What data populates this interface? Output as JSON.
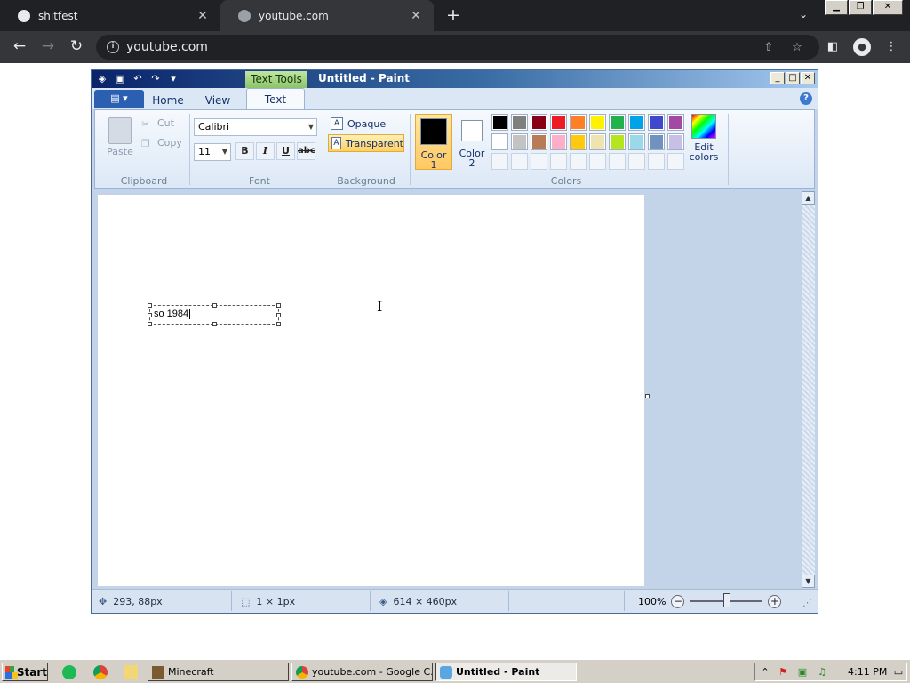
{
  "browser": {
    "tabs": [
      {
        "title": "shitfest",
        "close": "✕"
      },
      {
        "title": "youtube.com",
        "close": "✕"
      }
    ],
    "new_tab": "+",
    "url": "youtube.com",
    "window_controls": [
      "▁",
      "❐",
      "✕"
    ]
  },
  "paint": {
    "contextual_tab": "Text Tools",
    "title": "Untitled - Paint",
    "file_menu": "▤ ▾",
    "tabs": [
      "Home",
      "View",
      "Text"
    ],
    "active_tab": "Text",
    "clipboard": {
      "paste": "Paste",
      "cut": "Cut",
      "copy": "Copy",
      "label": "Clipboard"
    },
    "font": {
      "family": "Calibri",
      "size": "11",
      "bold": "B",
      "italic": "I",
      "underline": "U",
      "strike": "abc",
      "label": "Font"
    },
    "background": {
      "opaque": "Opaque",
      "transparent": "Transparent",
      "label": "Background"
    },
    "colors": {
      "color1": {
        "line1": "Color",
        "line2": "1",
        "value": "#000000"
      },
      "color2": {
        "line1": "Color",
        "line2": "2",
        "value": "#ffffff"
      },
      "edit": {
        "line1": "Edit",
        "line2": "colors"
      },
      "label": "Colors",
      "palette_row1": [
        "#000000",
        "#7f7f7f",
        "#880015",
        "#ed1c24",
        "#ff7f27",
        "#fff200",
        "#22b14c",
        "#00a2e8",
        "#3f48cc",
        "#a349a4"
      ],
      "palette_row2": [
        "#ffffff",
        "#c3c3c3",
        "#b97a57",
        "#ffaec9",
        "#ffc90e",
        "#efe4b0",
        "#b5e61d",
        "#99d9ea",
        "#7092be",
        "#c8bfe7"
      ]
    },
    "canvas": {
      "text": "so 1984"
    },
    "status": {
      "cursor_pos": "293, 88px",
      "selection": "1 × 1px",
      "image_size": "614 × 460px",
      "zoom": "100%"
    }
  },
  "taskbar": {
    "start": "Start",
    "tasks": [
      "Minecraft",
      "youtube.com - Google C...",
      "Untitled - Paint"
    ],
    "time": "4:11 PM"
  }
}
